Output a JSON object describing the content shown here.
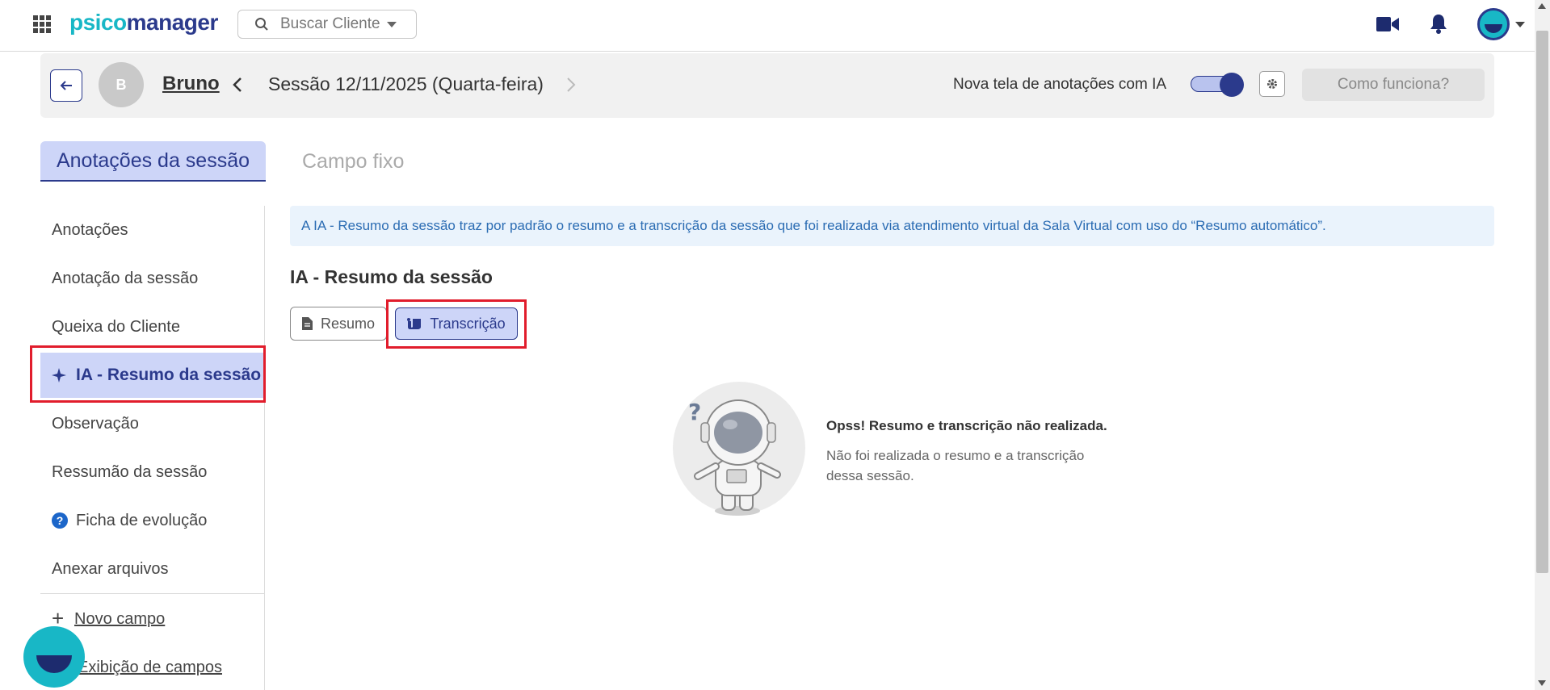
{
  "topbar": {
    "logo_part1": "psico",
    "logo_part2": "manager",
    "search_placeholder": "Buscar Cliente"
  },
  "session_header": {
    "client_initial": "B",
    "client_name": "Bruno",
    "session_title": "Sessão 12/11/2025 (Quarta-feira)",
    "ai_toggle_label": "Nova tela de anotações com IA",
    "ai_toggle_on": true,
    "how_it_works_label": "Como funciona?"
  },
  "tabs": {
    "active": "Anotações da sessão",
    "inactive": "Campo fixo"
  },
  "sidebar": {
    "items": [
      {
        "label": "Anotações"
      },
      {
        "label": "Anotação da sessão"
      },
      {
        "label": "Queixa do Cliente"
      },
      {
        "label": "IA - Resumo da sessão",
        "active": true
      },
      {
        "label": "Observação"
      },
      {
        "label": "Ressumão da sessão"
      },
      {
        "label": "Ficha de evolução",
        "icon": "help-icon"
      },
      {
        "label": "Anexar arquivos"
      }
    ],
    "help_glyph": "?",
    "new_field_label": "Novo campo",
    "fields_display_label": "Exibição de campos"
  },
  "main": {
    "info_text": "A IA - Resumo da sessão traz por padrão o resumo e a transcrição da sessão que foi realizada via atendimento virtual da Sala Virtual com uso do “Resumo automático”.",
    "section_title": "IA - Resumo da sessão",
    "buttons": {
      "summary_label": "Resumo",
      "transcription_label": "Transcrição",
      "selected": "Transcrição"
    },
    "empty_state": {
      "title": "Opss! Resumo e transcrição não realizada.",
      "description": "Não foi realizada o resumo e a transcrição dessa sessão."
    }
  },
  "colors": {
    "brand_dark": "#2b3a8c",
    "brand_teal": "#18b7c6",
    "highlight_red": "#e11d2c",
    "active_bg": "#cdd5f8",
    "info_text": "#2b6cb3"
  }
}
